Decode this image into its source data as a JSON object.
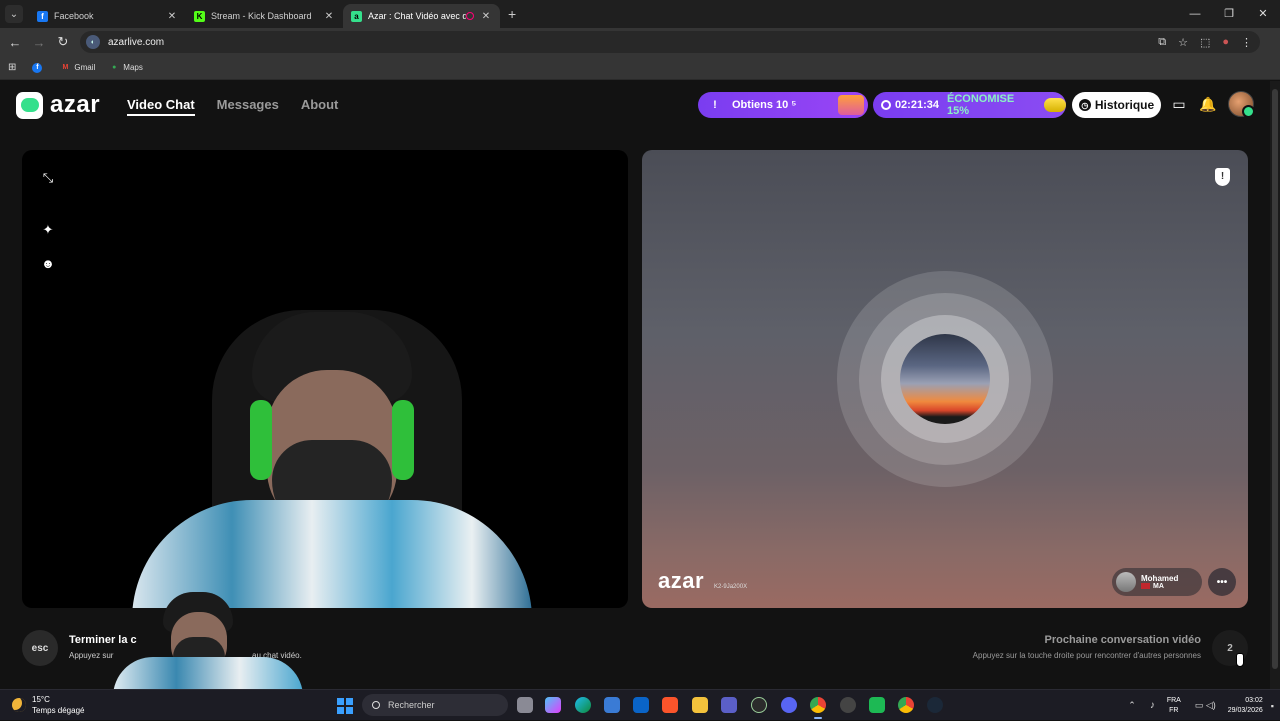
{
  "browser": {
    "tabs": [
      {
        "title": "Facebook",
        "icon": "facebook-icon",
        "color": "#1877f2",
        "glyph": "f"
      },
      {
        "title": "Stream - Kick Dashboard",
        "icon": "kick-icon",
        "color": "#53fc18",
        "glyph": "K"
      },
      {
        "title": "Azar : Chat Vidéo avec de n",
        "icon": "azar-icon",
        "color": "#35e08c",
        "glyph": "a",
        "active": true
      }
    ],
    "url": "azarlive.com",
    "bookmarks": [
      {
        "label": "",
        "icon": "facebook-icon",
        "color": "#1877f2",
        "glyph": "f"
      },
      {
        "label": "Gmail",
        "icon": "gmail-icon",
        "color": "#ea4335",
        "glyph": "M"
      },
      {
        "label": "Maps",
        "icon": "maps-icon",
        "color": "#34a853",
        "glyph": "●"
      }
    ]
  },
  "app": {
    "logo": "azar",
    "nav": [
      {
        "label": "Video Chat",
        "active": true
      },
      {
        "label": "Messages",
        "active": false
      },
      {
        "label": "About",
        "active": false
      }
    ],
    "promo_offer": {
      "bang": "!",
      "label": "Obtiens 10 ⁵"
    },
    "promo_timer": {
      "time": "02:21:34",
      "save": "ÉCONOMISE 15%"
    },
    "history_label": "Historique",
    "accent": "#8b4cf3",
    "brand_green": "#35e08c"
  },
  "remote": {
    "watermark": "azar",
    "id": "K2-9Ja200X",
    "user_name": "Mohamed",
    "country": "MA"
  },
  "bottom": {
    "esc_key": "esc",
    "end_title": "Terminer la c",
    "end_sub_a": "Appuyez sur",
    "end_sub_b": "au chat vidéo.",
    "next_title": "Prochaine conversation vidéo",
    "next_sub": "Appuyez sur la touche droite pour rencontrer d'autres personnes",
    "next_key": "2"
  },
  "taskbar": {
    "temp": "15°C",
    "weather": "Temps dégagé",
    "search_placeholder": "Rechercher",
    "lang_top": "FRA",
    "lang_bottom": "FR",
    "time": "03:02",
    "date": "29/03/2026"
  }
}
